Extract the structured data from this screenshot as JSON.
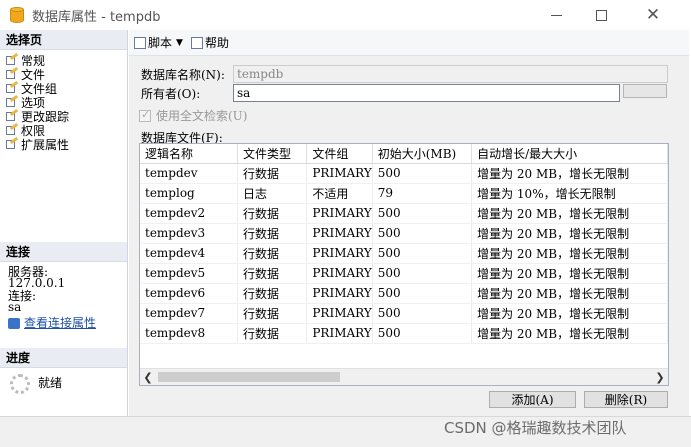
{
  "window": {
    "title": "数据库属性 - tempdb"
  },
  "left": {
    "select_page_header": "选择页",
    "pages": [
      "常规",
      "文件",
      "文件组",
      "选项",
      "更改跟踪",
      "权限",
      "扩展属性"
    ],
    "connection_header": "连接",
    "server_label": "服务器:",
    "server_value": "127.0.0.1",
    "connection_label": "连接:",
    "connection_value": "sa",
    "view_connection_link": "查看连接属性",
    "progress_header": "进度",
    "status": "就绪"
  },
  "toolbar": {
    "script_label": "脚本",
    "help_label": "帮助"
  },
  "form": {
    "db_name_label": "数据库名称(N):",
    "db_name_value": "tempdb",
    "owner_label": "所有者(O):",
    "owner_value": "sa",
    "fulltext_label": "使用全文检索(U)",
    "db_files_label": "数据库文件(F):"
  },
  "files_table": {
    "headers": [
      "逻辑名称",
      "文件类型",
      "文件组",
      "初始大小(MB)",
      "自动增长/最大大小"
    ],
    "rows": [
      [
        "tempdev",
        "行数据",
        "PRIMARY",
        "500",
        "增量为 20 MB，增长无限制"
      ],
      [
        "templog",
        "日志",
        "不适用",
        "79",
        "增量为 10%，增长无限制"
      ],
      [
        "tempdev2",
        "行数据",
        "PRIMARY",
        "500",
        "增量为 20 MB，增长无限制"
      ],
      [
        "tempdev3",
        "行数据",
        "PRIMARY",
        "500",
        "增量为 20 MB，增长无限制"
      ],
      [
        "tempdev4",
        "行数据",
        "PRIMARY",
        "500",
        "增量为 20 MB，增长无限制"
      ],
      [
        "tempdev5",
        "行数据",
        "PRIMARY",
        "500",
        "增量为 20 MB，增长无限制"
      ],
      [
        "tempdev6",
        "行数据",
        "PRIMARY",
        "500",
        "增量为 20 MB，增长无限制"
      ],
      [
        "tempdev7",
        "行数据",
        "PRIMARY",
        "500",
        "增量为 20 MB，增长无限制"
      ],
      [
        "tempdev8",
        "行数据",
        "PRIMARY",
        "500",
        "增量为 20 MB，增长无限制"
      ]
    ]
  },
  "buttons": {
    "add_label": "添加(A)",
    "remove_label": "删除(R)"
  },
  "watermark": "CSDN @格瑞趣数技术团队"
}
